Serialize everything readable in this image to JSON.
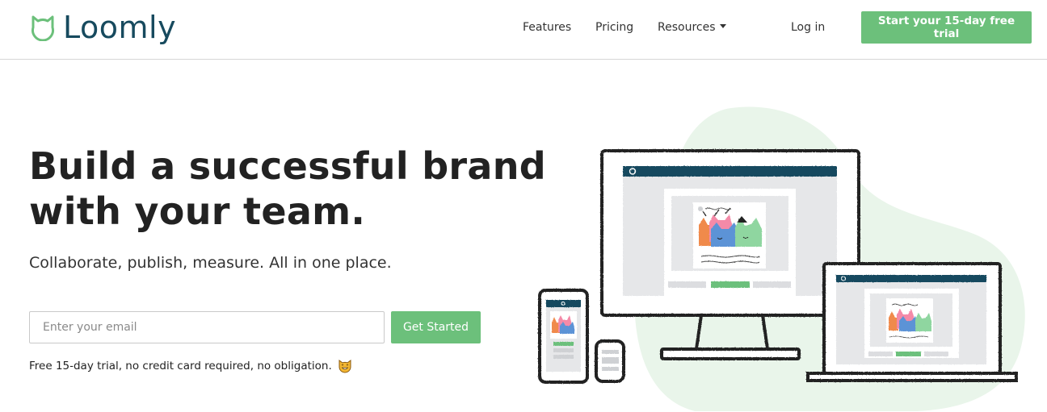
{
  "header": {
    "logo_text": "Loomly",
    "nav": {
      "features": "Features",
      "pricing": "Pricing",
      "resources": "Resources",
      "login": "Log in"
    },
    "cta": "Start your 15-day free trial"
  },
  "hero": {
    "title_line1": "Build a successful brand",
    "title_line2": "with your team.",
    "subtitle": "Collaborate, publish, measure. All in one place.",
    "email_placeholder": "Enter your email",
    "submit_label": "Get Started",
    "note": "Free 15-day trial, no credit card required, no obligation."
  },
  "colors": {
    "brand_green": "#6cc07b",
    "brand_navy": "#174a5e",
    "blob": "#e9f5ea"
  },
  "icons": {
    "logo": "loomly-cat-icon",
    "resources_dropdown": "caret-down-icon",
    "note_emoji": "cat-face-emoji-icon"
  }
}
